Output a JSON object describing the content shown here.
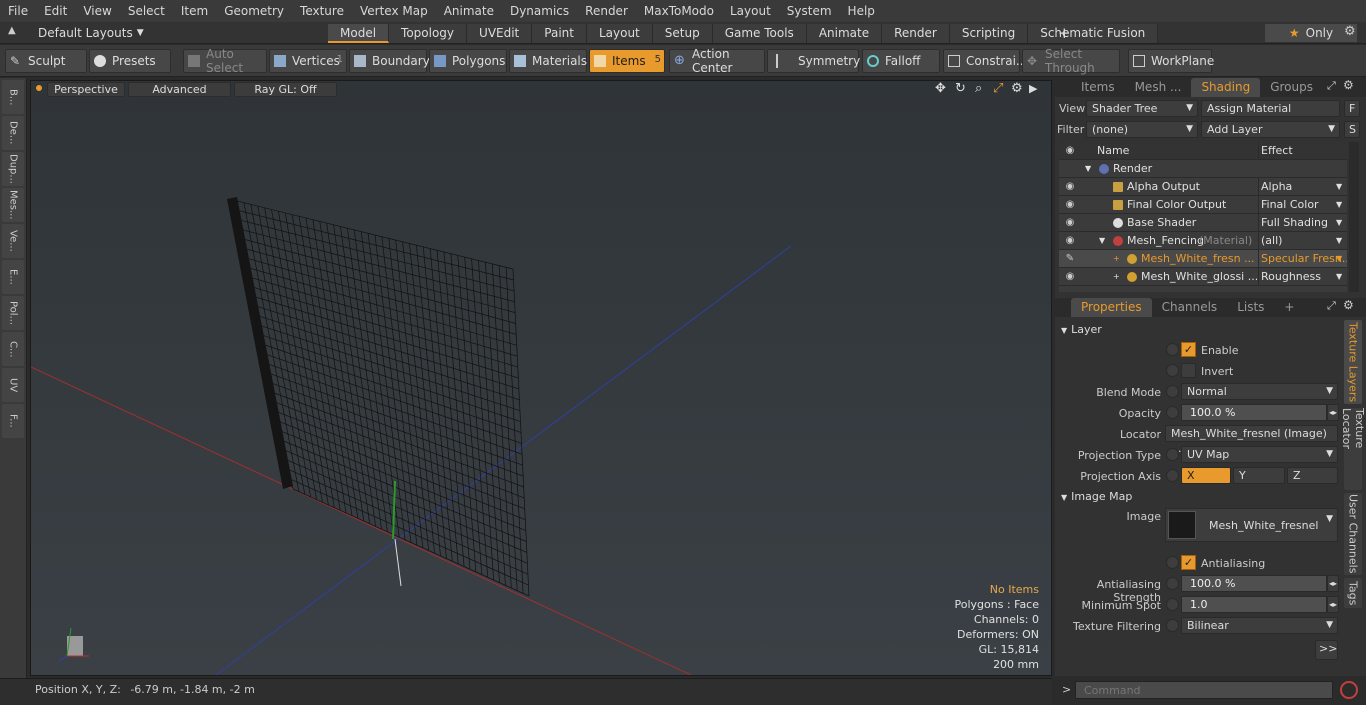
{
  "menu": [
    "File",
    "Edit",
    "View",
    "Select",
    "Item",
    "Geometry",
    "Texture",
    "Vertex Map",
    "Animate",
    "Dynamics",
    "Render",
    "MaxToModo",
    "Layout",
    "System",
    "Help"
  ],
  "layouts_label": "Default Layouts",
  "mode_tabs": [
    "Model",
    "Topology",
    "UVEdit",
    "Paint",
    "Layout",
    "Setup",
    "Game Tools",
    "Animate",
    "Render",
    "Scripting",
    "Schematic Fusion"
  ],
  "active_mode_tab": "Model",
  "add_tab": "+",
  "only_label": "Only",
  "toolbar": {
    "sculpt": "Sculpt",
    "presets": "Presets",
    "auto_select": "Auto Select",
    "vertices": "Vertices",
    "vertices_count": "1",
    "boundary": "Boundary",
    "polygons": "Polygons",
    "materials": "Materials",
    "items": "Items",
    "items_count": "5",
    "action_center": "Action Center",
    "symmetry": "Symmetry",
    "falloff": "Falloff",
    "constraints": "Constrai...",
    "select_through": "Select Through",
    "workplane": "WorkPlane"
  },
  "left_tabs": [
    "B...",
    "De...",
    "Dup...",
    "Mes...",
    "Ve...",
    "E...",
    "Pol...",
    "C...",
    "UV",
    "F..."
  ],
  "viewport": {
    "view_mode": "Perspective",
    "advanced": "Advanced",
    "raygl": "Ray GL: Off",
    "info": {
      "no_items": "No Items",
      "polygons": "Polygons : Face",
      "channels": "Channels: 0",
      "deformers": "Deformers: ON",
      "gl": "GL: 15,814",
      "scale": "200 mm"
    }
  },
  "status": {
    "position_label": "Position X, Y, Z:",
    "position_value": "-6.79 m, -1.84 m, -2 m"
  },
  "top_right_tabs": [
    "Items",
    "Mesh ...",
    "Shading",
    "Groups"
  ],
  "top_right_active": "Shading",
  "shading": {
    "view_label": "View",
    "view_value": "Shader Tree",
    "assign_material": "Assign Material",
    "f_button": "F",
    "filter_label": "Filter",
    "filter_value": "(none)",
    "add_layer": "Add Layer",
    "s_button": "S",
    "col_name": "Name",
    "col_effect": "Effect",
    "rows": [
      {
        "name": "Render",
        "effect": "",
        "indent": 0
      },
      {
        "name": "Alpha Output",
        "effect": "Alpha",
        "indent": 1
      },
      {
        "name": "Final Color Output",
        "effect": "Final Color",
        "indent": 1
      },
      {
        "name": "Base Shader",
        "effect": "Full Shading",
        "indent": 1
      },
      {
        "name": "Mesh_Fencing",
        "tag": "(Material)",
        "effect": "(all)",
        "indent": 1
      },
      {
        "name": "Mesh_White_fresn ...",
        "effect": "Specular Fresn...",
        "indent": 2
      },
      {
        "name": "Mesh_White_glossi ...",
        "effect": "Roughness",
        "indent": 2
      }
    ]
  },
  "bottom_right_tabs": [
    "Properties",
    "Channels",
    "Lists"
  ],
  "bottom_right_active": "Properties",
  "side_tabs": [
    "Texture Layers",
    "Texture Locator",
    "User Channels",
    "Tags"
  ],
  "properties": {
    "layer_header": "Layer",
    "enable": "Enable",
    "invert": "Invert",
    "blend_mode_label": "Blend Mode",
    "blend_mode": "Normal",
    "opacity_label": "Opacity",
    "opacity": "100.0 %",
    "locator_label": "Locator",
    "locator": "Mesh_White_fresnel (Image) ...",
    "projection_type_label": "Projection Type",
    "projection_type": "UV Map",
    "projection_axis_label": "Projection Axis",
    "axis_x": "X",
    "axis_y": "Y",
    "axis_z": "Z",
    "image_map_header": "Image Map",
    "image_label": "Image",
    "image_value": "Mesh_White_fresnel",
    "antialiasing": "Antialiasing",
    "aa_strength_label": "Antialiasing Strength",
    "aa_strength": "100.0 %",
    "min_spot_label": "Minimum Spot",
    "min_spot": "1.0",
    "tex_filter_label": "Texture Filtering",
    "tex_filter": "Bilinear",
    "more": ">>"
  },
  "command_placeholder": "Command",
  "colors": {
    "accent": "#e89a2c",
    "panel": "#323232",
    "viewport": "#353a3f"
  }
}
